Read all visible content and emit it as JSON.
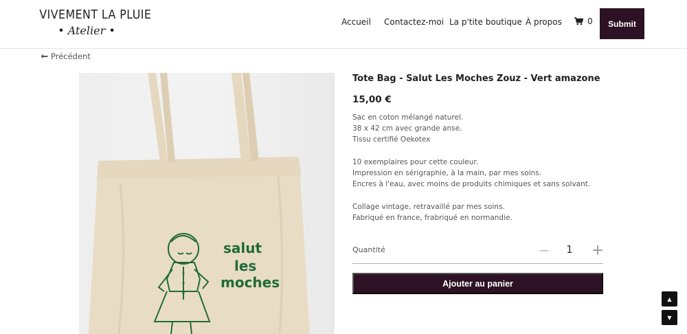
{
  "header": {
    "logo_line1": "VIVEMENT LA PLUIE",
    "logo_line2": "• Atelier •",
    "nav": [
      "Accueil",
      "Contactez-moi",
      "La p'tite boutique",
      "À propos"
    ],
    "cart_count": "0",
    "submit_label": "Submit",
    "cart_icon": "shopping-cart-icon"
  },
  "back": {
    "label": "Précédent",
    "icon": "arrow-left-icon"
  },
  "product": {
    "title": "Tote Bag - Salut Les Moches Zouz - Vert amazone",
    "price": "15,00 €",
    "description": [
      "Sac en coton mélangé naturel.",
      "38 x 42 cm avec grande anse.",
      "Tissu certifié Oekotex",
      "",
      "10 exemplaires pour cette couleur.",
      "Impression en sérigraphie, à la main, par mes soins.",
      "Encres à l'eau, avec moins de produits chimiques et sans solvant.",
      "",
      "Collage vintage, retravaillé par mes soins.",
      "Fabriqué en france, frabriqué en normandie."
    ],
    "print_text": [
      "salut",
      "les",
      "moches"
    ],
    "quantity_label": "Quantité",
    "quantity_value": "1",
    "add_to_cart_label": "Ajouter au panier"
  },
  "colors": {
    "accent": "#2c1224",
    "print_green": "#1f6b3a",
    "bag_canvas": "#e9dcc4",
    "qty_underline": "#b9a3c4"
  }
}
